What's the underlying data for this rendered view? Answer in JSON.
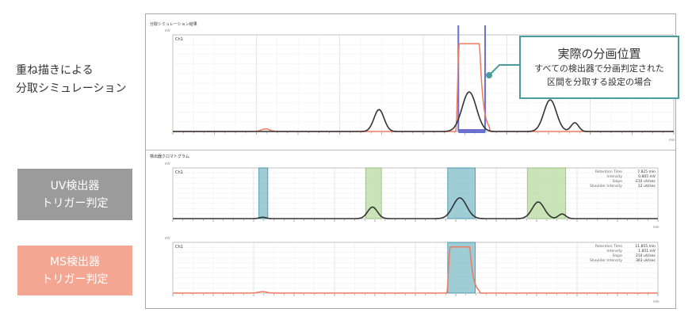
{
  "labels": {
    "overlay_line1": "重ね描きによる",
    "overlay_line2": "分取シミュレーション",
    "uv_line1": "UV検出器",
    "uv_line2": "トリガー判定",
    "ms_line1": "MS検出器",
    "ms_line2": "トリガー判定"
  },
  "colors": {
    "uv_box": "#9b9b9b",
    "ms_box": "#f4a692",
    "callout_border": "#4a9d9a",
    "trace_black": "#333333",
    "trace_red": "#f07a5e",
    "fraction_band": "#6a6fd0",
    "fraction_teal": "#7fbcc7",
    "fraction_green": "#b8dba0"
  },
  "callout": {
    "title": "実際の分画位置",
    "line1": "すべての検出器で分画判定された",
    "line2": "区間を分取する設定の場合"
  },
  "panel": {
    "sim_title": "分取シミュレーション結果",
    "det_title": "検出器クロマトグラム",
    "unit_y": "mV",
    "unit_x": "min",
    "ch_label": "Ch1"
  },
  "info_uv": {
    "keys": [
      "Retention Time",
      "Intensity",
      "Slope",
      "Shoulder Intensity"
    ],
    "vals": [
      "7.825 min",
      "0.805 mV",
      "-210 uV/sec",
      "12 uV/sec"
    ]
  },
  "info_ms": {
    "keys": [
      "Retention Time",
      "Intensity",
      "Slope",
      "Shoulder Intensity"
    ],
    "vals": [
      "11.855 min",
      "1.851 mV",
      "210 uV/sec",
      "303 uV/sec"
    ]
  },
  "chart_data": {
    "type": "line",
    "x_unit": "min",
    "xlim": [
      0,
      12
    ],
    "ylim": [
      0,
      1.1
    ],
    "black_peaks": [
      {
        "t": 4.94,
        "h": 0.25,
        "w": 0.12
      },
      {
        "t": 7.1,
        "h": 0.45,
        "w": 0.17
      },
      {
        "t": 9.04,
        "h": 0.36,
        "w": 0.15
      },
      {
        "t": 9.63,
        "h": 0.1,
        "w": 0.09
      }
    ],
    "red_peaks": [
      {
        "t": 2.22,
        "h": 0.03,
        "w": 0.1
      }
    ],
    "red_plateau": {
      "start": 6.85,
      "end": 7.35,
      "h": 1.0
    },
    "sim_fraction": [
      6.84,
      7.48
    ],
    "uv_fractions": [
      {
        "range": [
          2.13,
          2.35
        ],
        "color": "teal"
      },
      {
        "range": [
          4.77,
          5.16
        ],
        "color": "green"
      },
      {
        "range": [
          6.8,
          7.48
        ],
        "color": "teal"
      },
      {
        "range": [
          8.77,
          9.72
        ],
        "color": "green"
      }
    ],
    "ms_fractions": [
      {
        "range": [
          6.8,
          7.48
        ],
        "color": "teal"
      }
    ]
  }
}
